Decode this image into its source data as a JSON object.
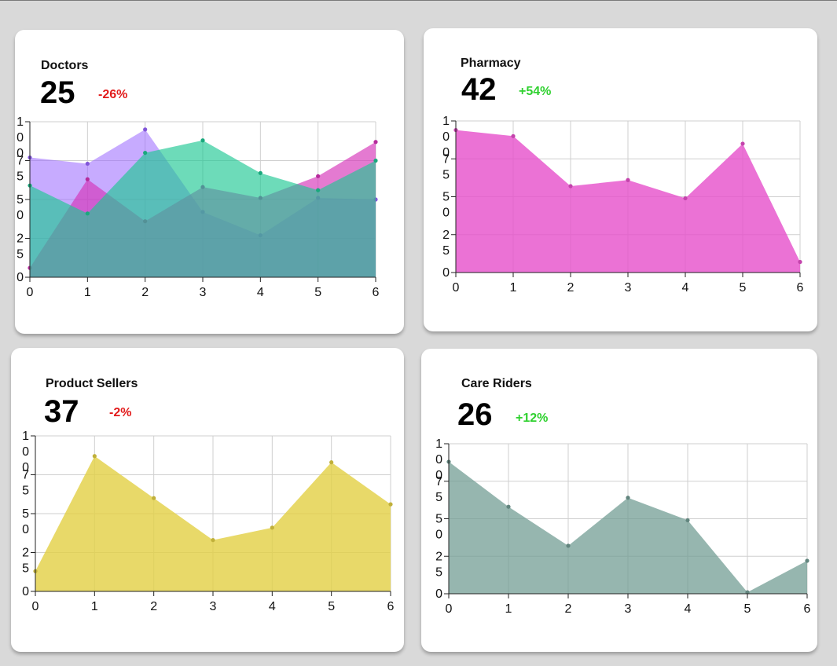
{
  "cards": [
    {
      "id": "doctors",
      "title": "Doctors",
      "value": "25",
      "change": "-26%",
      "change_trend": "negative",
      "chart_data": {
        "type": "area",
        "x": [
          0,
          1,
          2,
          3,
          4,
          5,
          6
        ],
        "ylim": [
          0,
          100
        ],
        "yticks": [
          0,
          25,
          50,
          75,
          100
        ],
        "grid": true,
        "series": [
          {
            "color": "#9966ff",
            "opacity": 0.55,
            "values": [
              77,
              73,
              95,
              42,
              27,
              51,
              50
            ]
          },
          {
            "color": "#d633b8",
            "opacity": 0.65,
            "values": [
              6,
              63,
              36,
              58,
              51,
              65,
              87
            ]
          },
          {
            "color": "#1ec793",
            "opacity": 0.65,
            "values": [
              59,
              41,
              80,
              88,
              67,
              56,
              75
            ]
          }
        ]
      }
    },
    {
      "id": "pharmacy",
      "title": "Pharmacy",
      "value": "42",
      "change": "+54%",
      "change_trend": "positive",
      "chart_data": {
        "type": "area",
        "x": [
          0,
          1,
          2,
          3,
          4,
          5,
          6
        ],
        "ylim": [
          0,
          100
        ],
        "yticks": [
          0,
          25,
          50,
          75,
          100
        ],
        "grid": true,
        "series": [
          {
            "color": "#e64fca",
            "opacity": 0.8,
            "values": [
              94,
              90,
              57,
              61,
              49,
              85,
              7
            ]
          }
        ]
      }
    },
    {
      "id": "product-sellers",
      "title": "Product Sellers",
      "value": "37",
      "change": "-2%",
      "change_trend": "negative",
      "chart_data": {
        "type": "area",
        "x": [
          0,
          1,
          2,
          3,
          4,
          5,
          6
        ],
        "ylim": [
          0,
          100
        ],
        "yticks": [
          0,
          25,
          50,
          75,
          100
        ],
        "grid": true,
        "series": [
          {
            "color": "#e2cf44",
            "opacity": 0.8,
            "values": [
              13,
              87,
              60,
              33,
              41,
              83,
              56
            ]
          }
        ]
      }
    },
    {
      "id": "care-riders",
      "title": "Care Riders",
      "value": "26",
      "change": "+12%",
      "change_trend": "positive",
      "chart_data": {
        "type": "area",
        "x": [
          0,
          1,
          2,
          3,
          4,
          5,
          6
        ],
        "ylim": [
          0,
          100
        ],
        "yticks": [
          0,
          25,
          50,
          75,
          100
        ],
        "grid": true,
        "series": [
          {
            "color": "#739d94",
            "opacity": 0.75,
            "values": [
              88,
              58,
              32,
              64,
              49,
              1,
              22
            ]
          }
        ]
      }
    }
  ]
}
